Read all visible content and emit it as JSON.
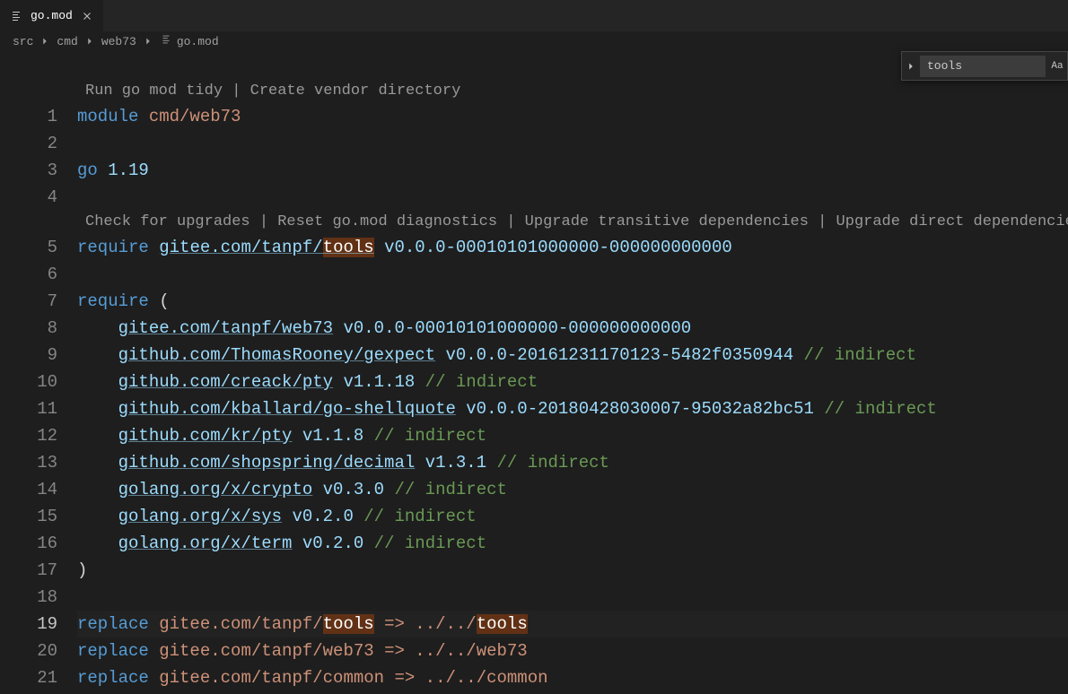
{
  "tab": {
    "filename": "go.mod"
  },
  "breadcrumbs": {
    "segments": [
      "src",
      "cmd",
      "web73"
    ],
    "file": "go.mod"
  },
  "search": {
    "value": "tools",
    "caseSensitiveLabel": "Aa"
  },
  "codelens": {
    "top": "Run go mod tidy | Create vendor directory",
    "require": "Check for upgrades | Reset go.mod diagnostics | Upgrade transitive dependencies | Upgrade direct dependencies"
  },
  "lineNumbers": [
    "1",
    "2",
    "3",
    "4",
    "5",
    "6",
    "7",
    "8",
    "9",
    "10",
    "11",
    "12",
    "13",
    "14",
    "15",
    "16",
    "17",
    "18",
    "19",
    "20",
    "21"
  ],
  "activeLine": "19",
  "code": {
    "module_kw": "module",
    "module_name": " cmd/web73",
    "go_kw": "go",
    "go_ver": " 1.19",
    "require_kw": "require",
    "req1_prefix": "gitee.com/tanpf/",
    "req1_hl": "tools",
    "req1_ver": " v0.0.0-00010101000000-000000000000",
    "req_open": " (",
    "req_close": ")",
    "indirect": " // indirect",
    "deps": [
      {
        "path": "gitee.com/tanpf/web73",
        "ver": " v0.0.0-00010101000000-000000000000",
        "indirect": false
      },
      {
        "path": "github.com/ThomasRooney/gexpect",
        "ver": " v0.0.0-20161231170123-5482f0350944",
        "indirect": true
      },
      {
        "path": "github.com/creack/pty",
        "ver": " v1.1.18",
        "indirect": true
      },
      {
        "path": "github.com/kballard/go-shellquote",
        "ver": " v0.0.0-20180428030007-95032a82bc51",
        "indirect": true
      },
      {
        "path": "github.com/kr/pty",
        "ver": " v1.1.8",
        "indirect": true
      },
      {
        "path": "github.com/shopspring/decimal",
        "ver": " v1.3.1",
        "indirect": true
      },
      {
        "path": "golang.org/x/crypto",
        "ver": " v0.3.0",
        "indirect": true
      },
      {
        "path": "golang.org/x/sys",
        "ver": " v0.2.0",
        "indirect": true
      },
      {
        "path": "golang.org/x/term",
        "ver": " v0.2.0",
        "indirect": true
      }
    ],
    "replace_kw": "replace",
    "rep1_prefix": " gitee.com/tanpf/",
    "rep1_hl1": "tools",
    "rep1_mid": " => ../../",
    "rep1_hl2": "tools",
    "rep2": " gitee.com/tanpf/web73 => ../../web73",
    "rep3": " gitee.com/tanpf/common => ../../common"
  }
}
